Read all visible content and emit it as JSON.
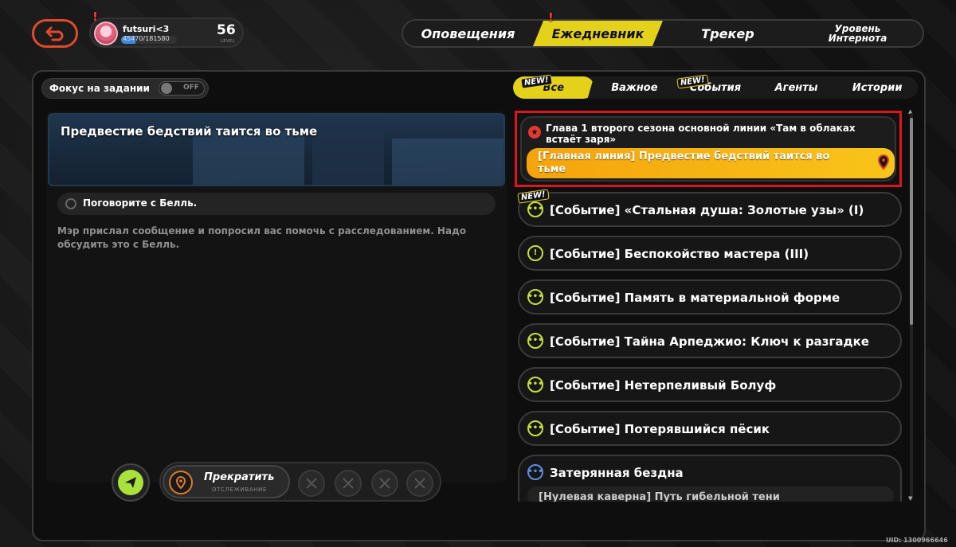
{
  "profile": {
    "name": "futsuri<3",
    "xp": "45470/181580",
    "xp_fraction": 0.25,
    "level": "56",
    "level_label": "LEVEL",
    "alert": "!"
  },
  "topnav": {
    "tabs": [
      {
        "label": "Оповещения",
        "active": false
      },
      {
        "label": "Ежедневник",
        "active": true,
        "alert": "!"
      },
      {
        "label": "Трекер",
        "active": false
      },
      {
        "label": "Уровень Интернота",
        "active": false
      }
    ]
  },
  "focus": {
    "label": "Фокус на задании",
    "toggle": "OFF"
  },
  "filters": {
    "tabs": [
      {
        "label": "Все",
        "active": true,
        "badge": "NEW!"
      },
      {
        "label": "Важное"
      },
      {
        "label": "События",
        "badge": "NEW!"
      },
      {
        "label": "Агенты"
      },
      {
        "label": "Истории"
      }
    ]
  },
  "detail": {
    "title": "Предвестие бедствий таится во тьме",
    "objective": "Поговорите с Белль.",
    "description": "Мэр прислал сообщение и попросил вас помочь с расследованием. Надо обсудить это с Белль."
  },
  "actions": {
    "stop_label": "Прекратить",
    "stop_sub": "ОТСЛЕЖИВАНИЕ"
  },
  "main_quest": {
    "title": "Глава 1 второго сезона основной линии «Там в облаках встаёт заря»",
    "subtitle": "[Главная линия] Предвестие бедствий таится во тьме"
  },
  "quests": [
    {
      "label": "[Событие] «Стальная душа: Золотые узы» (I)",
      "icon": "dots",
      "badge": "NEW!"
    },
    {
      "label": "[Событие] Беспокойство мастера (III)",
      "icon": "exclamation"
    },
    {
      "label": "[Событие] Память в материальной форме",
      "icon": "dots"
    },
    {
      "label": "[Событие] Тайна Арпеджио: Ключ к разгадке",
      "icon": "dots"
    },
    {
      "label": "[Событие] Нетерпеливый Болуф",
      "icon": "dots"
    },
    {
      "label": "[Событие] Потерявшийся пёсик",
      "icon": "dots"
    },
    {
      "label": "Затерянная бездна",
      "icon": "dots-blue",
      "sub": "[Нулевая каверна] Путь гибельной тени"
    }
  ],
  "uid": "UID: 1300966646",
  "colors": {
    "accent_yellow": "#e4d21a",
    "quest_orange": "#f5a30c",
    "highlight_red": "#e0141e",
    "icon_green": "#c8e03a"
  }
}
